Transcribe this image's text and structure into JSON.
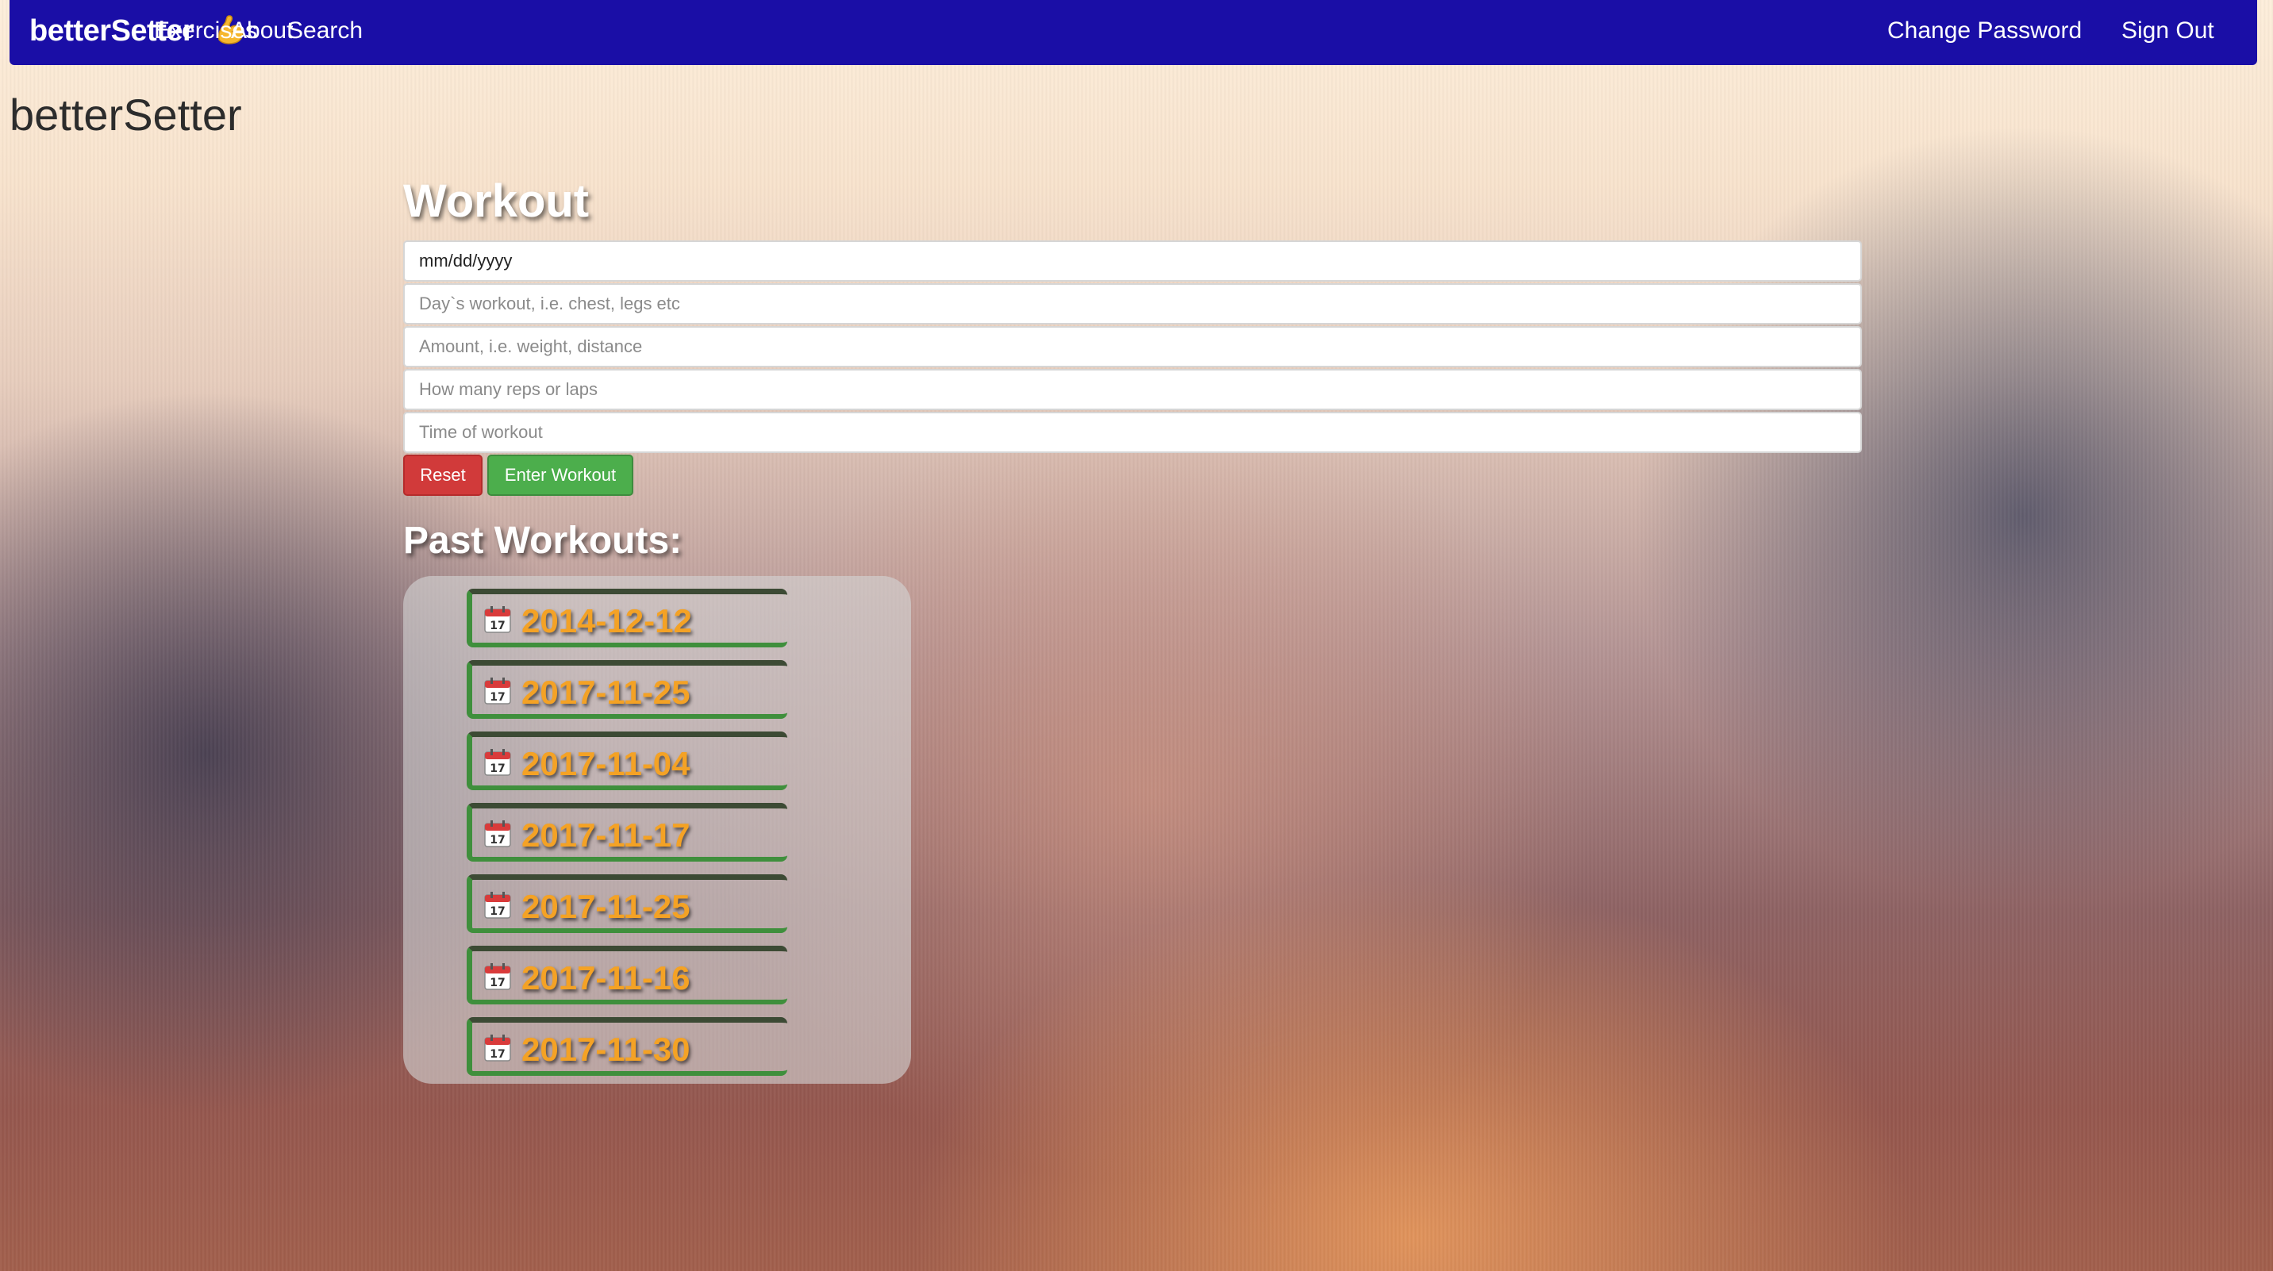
{
  "nav": {
    "brand": "betterSetter",
    "brand_icon": "flexed-biceps-icon",
    "links": [
      "Exercises",
      "About",
      "Search"
    ],
    "right_links": [
      "Change Password",
      "Sign Out"
    ],
    "color": "#1a0ea6"
  },
  "page": {
    "title": "betterSetter"
  },
  "workout_form": {
    "heading": "Workout",
    "date_placeholder": "mm/dd/yyyy",
    "workout_placeholder": "Day`s workout, i.e. chest, legs etc",
    "amount_placeholder": "Amount, i.e. weight, distance",
    "reps_placeholder": "How many reps or laps",
    "time_placeholder": "Time of workout",
    "reset_label": "Reset",
    "enter_label": "Enter Workout",
    "reset_color": "#d13a3a",
    "enter_color": "#4cae4c"
  },
  "past": {
    "heading": "Past Workouts:",
    "icon": "calendar-icon",
    "date_color": "#f4a225",
    "items": [
      "2014-12-12",
      "2017-11-25",
      "2017-11-04",
      "2017-11-17",
      "2017-11-25",
      "2017-11-16",
      "2017-11-30"
    ]
  }
}
